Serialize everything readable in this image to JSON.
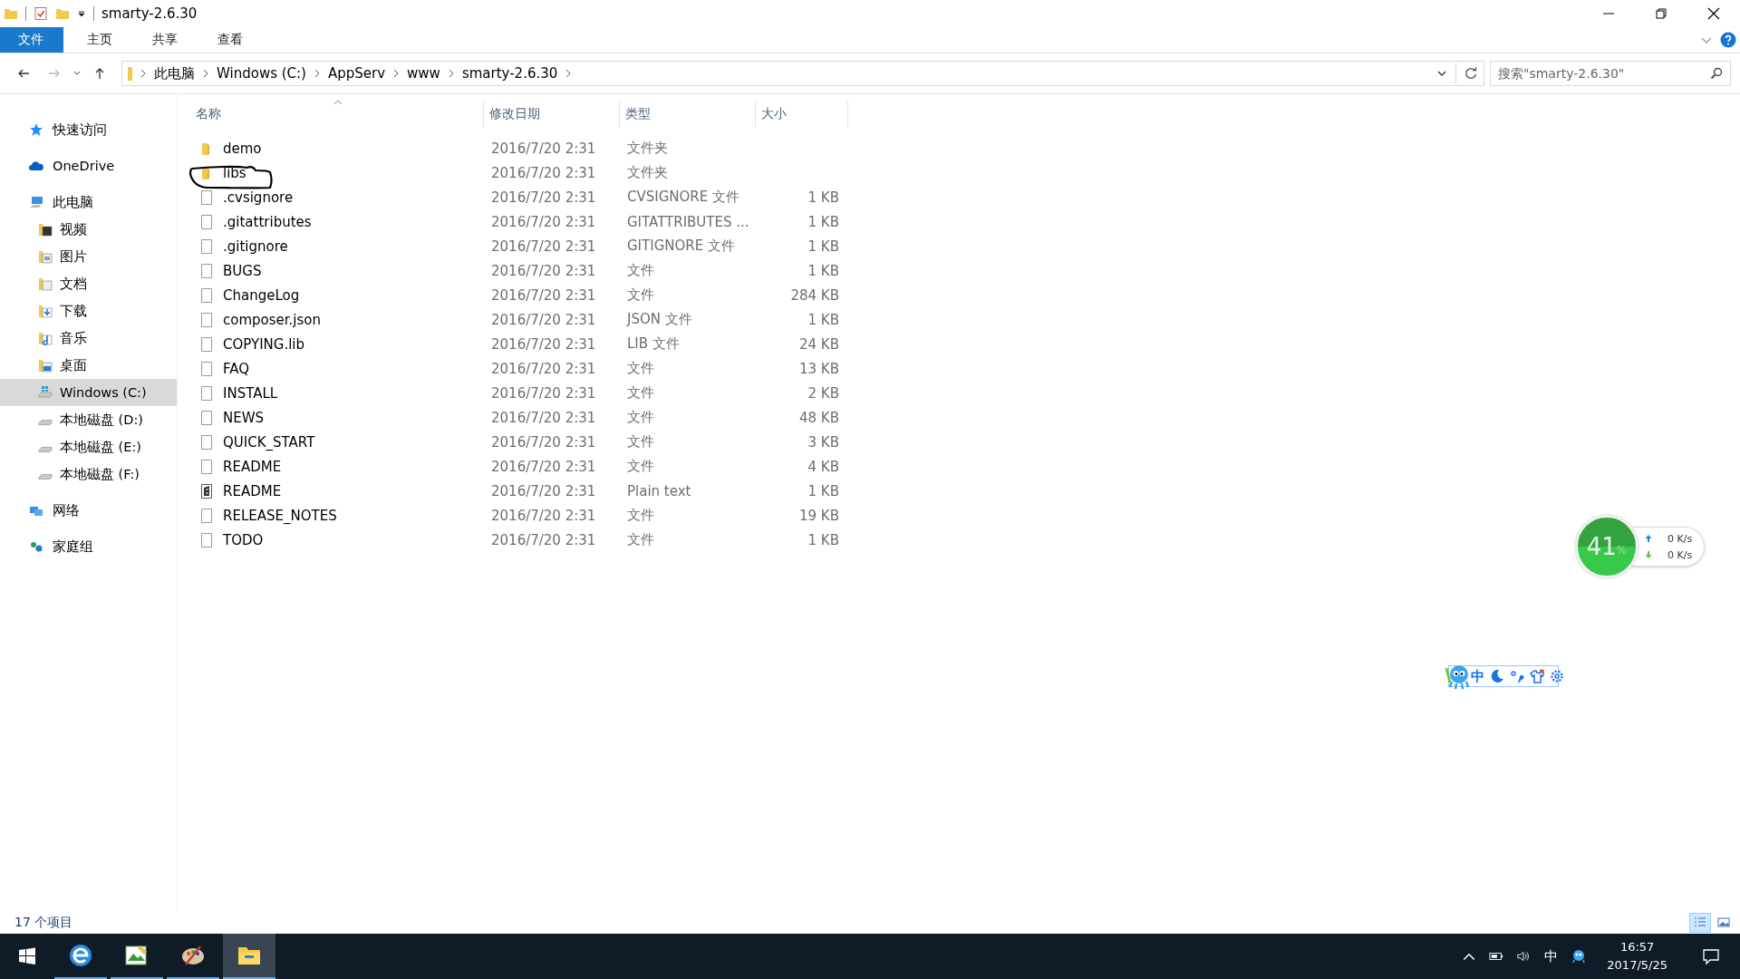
{
  "window": {
    "title": "smarty-2.6.30"
  },
  "ribbon_tabs": [
    {
      "label": "文件",
      "kind": "file"
    },
    {
      "label": "主页",
      "kind": "tab"
    },
    {
      "label": "共享",
      "kind": "tab"
    },
    {
      "label": "查看",
      "kind": "tab"
    }
  ],
  "address": {
    "path": [
      "此电脑",
      "Windows (C:)",
      "AppServ",
      "www",
      "smarty-2.6.30"
    ],
    "search_placeholder": "搜索\"smarty-2.6.30\""
  },
  "sidebar": {
    "items": [
      {
        "label": "快速访问",
        "kind": "star",
        "selected": false
      },
      {
        "label": "OneDrive",
        "kind": "cloud",
        "selected": false
      },
      {
        "label": "此电脑",
        "kind": "pc",
        "selected": false,
        "children": [
          {
            "label": "视频",
            "kind": "video",
            "selected": false
          },
          {
            "label": "图片",
            "kind": "picture",
            "selected": false
          },
          {
            "label": "文档",
            "kind": "doc",
            "selected": false
          },
          {
            "label": "下载",
            "kind": "download",
            "selected": false
          },
          {
            "label": "音乐",
            "kind": "music",
            "selected": false
          },
          {
            "label": "桌面",
            "kind": "desktop",
            "selected": false
          },
          {
            "label": "Windows (C:)",
            "kind": "windrive",
            "selected": true
          },
          {
            "label": "本地磁盘 (D:)",
            "kind": "drive",
            "selected": false
          },
          {
            "label": "本地磁盘 (E:)",
            "kind": "drive",
            "selected": false
          },
          {
            "label": "本地磁盘 (F:)",
            "kind": "drive",
            "selected": false
          }
        ]
      },
      {
        "label": "网络",
        "kind": "network",
        "selected": false
      },
      {
        "label": "家庭组",
        "kind": "homegroup",
        "selected": false
      }
    ]
  },
  "table": {
    "columns": [
      "名称",
      "修改日期",
      "类型",
      "大小"
    ],
    "rows": [
      {
        "name": "demo",
        "date": "2016/7/20 2:31",
        "type": "文件夹",
        "kind": "folder",
        "marked": false
      },
      {
        "name": "libs",
        "date": "2016/7/20 2:31",
        "type": "文件夹",
        "kind": "folder",
        "marked": true
      },
      {
        "name": ".cvsignore",
        "date": "2016/7/20 2:31",
        "type": "CVSIGNORE 文件",
        "size": "1 KB",
        "kind": "file",
        "marked": false
      },
      {
        "name": ".gitattributes",
        "date": "2016/7/20 2:31",
        "type": "GITATTRIBUTES ...",
        "size": "1 KB",
        "kind": "file",
        "marked": false
      },
      {
        "name": ".gitignore",
        "date": "2016/7/20 2:31",
        "type": "GITIGNORE 文件",
        "size": "1 KB",
        "kind": "file",
        "marked": false
      },
      {
        "name": "BUGS",
        "date": "2016/7/20 2:31",
        "type": "文件",
        "size": "1 KB",
        "kind": "file",
        "marked": false
      },
      {
        "name": "ChangeLog",
        "date": "2016/7/20 2:31",
        "type": "文件",
        "size": "284 KB",
        "kind": "file",
        "marked": false
      },
      {
        "name": "composer.json",
        "date": "2016/7/20 2:31",
        "type": "JSON 文件",
        "size": "1 KB",
        "kind": "file",
        "marked": false
      },
      {
        "name": "COPYING.lib",
        "date": "2016/7/20 2:31",
        "type": "LIB 文件",
        "size": "24 KB",
        "kind": "file",
        "marked": false
      },
      {
        "name": "FAQ",
        "date": "2016/7/20 2:31",
        "type": "文件",
        "size": "13 KB",
        "kind": "file",
        "marked": false
      },
      {
        "name": "INSTALL",
        "date": "2016/7/20 2:31",
        "type": "文件",
        "size": "2 KB",
        "kind": "file",
        "marked": false
      },
      {
        "name": "NEWS",
        "date": "2016/7/20 2:31",
        "type": "文件",
        "size": "48 KB",
        "kind": "file",
        "marked": false
      },
      {
        "name": "QUICK_START",
        "date": "2016/7/20 2:31",
        "type": "文件",
        "size": "3 KB",
        "kind": "file",
        "marked": false
      },
      {
        "name": "README",
        "date": "2016/7/20 2:31",
        "type": "文件",
        "size": "4 KB",
        "kind": "file",
        "marked": false
      },
      {
        "name": "README",
        "date": "2016/7/20 2:31",
        "type": "Plain text",
        "size": "1 KB",
        "kind": "text",
        "marked": false
      },
      {
        "name": "RELEASE_NOTES",
        "date": "2016/7/20 2:31",
        "type": "文件",
        "size": "19 KB",
        "kind": "file",
        "marked": false
      },
      {
        "name": "TODO",
        "date": "2016/7/20 2:31",
        "type": "文件",
        "size": "1 KB",
        "kind": "file",
        "marked": false
      }
    ]
  },
  "status_bar": {
    "count": "17 个项目",
    "views": [
      {
        "kind": "details",
        "selected": true
      },
      {
        "kind": "tiles",
        "selected": false
      }
    ]
  },
  "net_meter": {
    "percent": "41",
    "unit": "%",
    "upload": "0 K/s",
    "download": "0 K/s"
  },
  "ime_toolbar": {
    "mode": "中"
  },
  "taskbar": {
    "apps": [
      {
        "kind": "browser",
        "running": true,
        "selected": false
      },
      {
        "kind": "editor",
        "running": true,
        "selected": false
      },
      {
        "kind": "paint",
        "running": true,
        "selected": false
      },
      {
        "kind": "explorer",
        "running": true,
        "selected": true
      }
    ],
    "ime": "中",
    "time": "16:57",
    "date": "2017/5/25"
  }
}
